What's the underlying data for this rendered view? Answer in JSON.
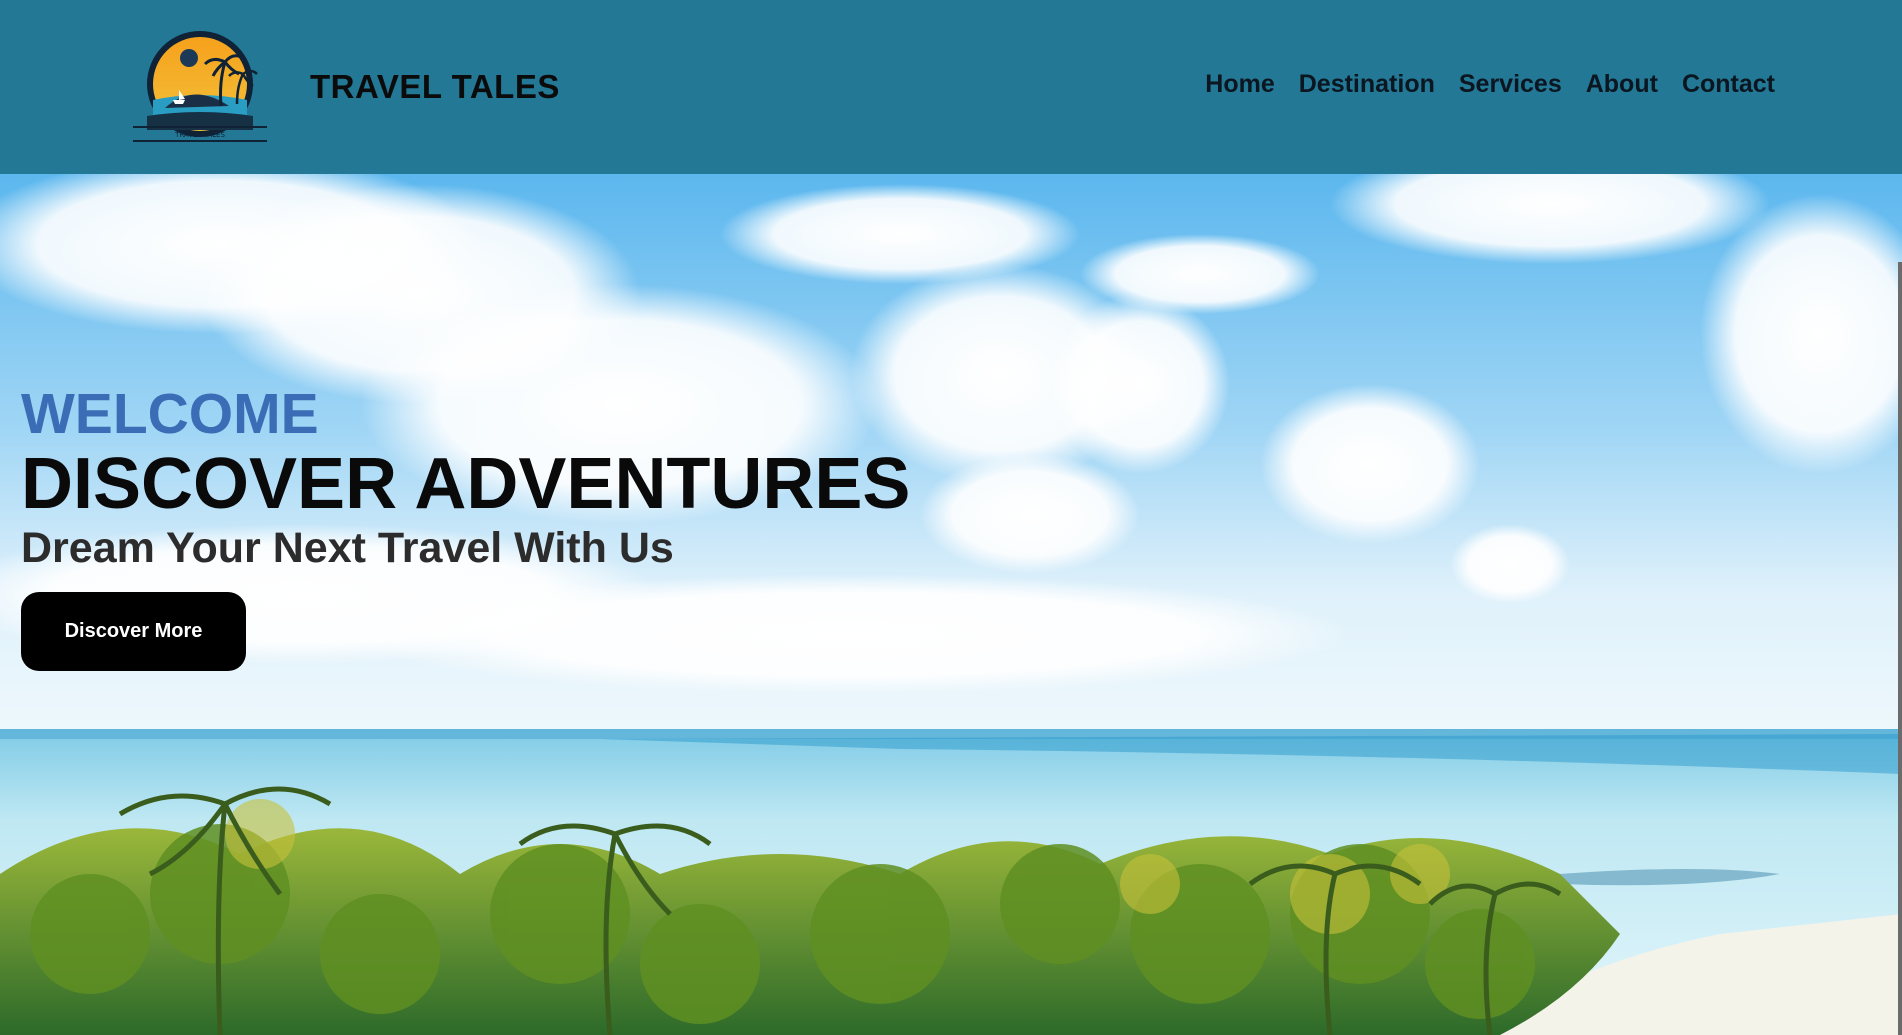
{
  "header": {
    "brand": "TRAVEL TALES",
    "logo_text": "TRAVEL TALES",
    "background": "#227895"
  },
  "nav": {
    "items": [
      {
        "label": "Home"
      },
      {
        "label": "Destination"
      },
      {
        "label": "Services"
      },
      {
        "label": "About"
      },
      {
        "label": "Contact"
      }
    ]
  },
  "hero": {
    "welcome": "WELCOME",
    "welcome_color": "#3a6db5",
    "headline": "DISCOVER ADVENTURES",
    "subhead": "Dream Your Next Travel With Us",
    "cta_label": "Discover More",
    "background_description_icon": "tropical-beach-photo"
  }
}
